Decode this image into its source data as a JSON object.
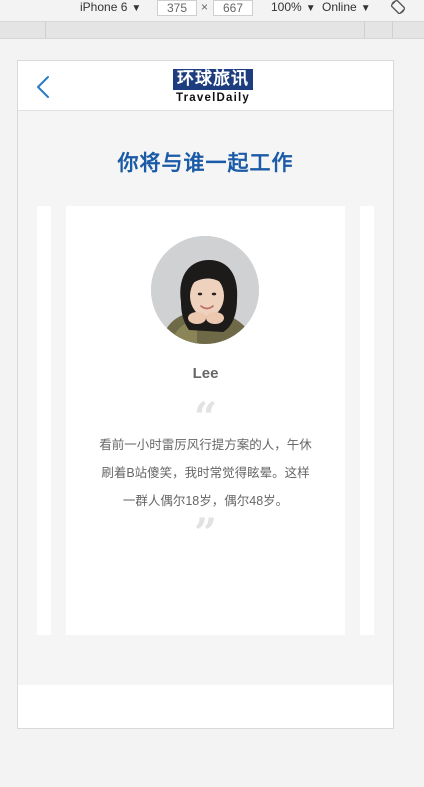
{
  "devtools": {
    "device": "iPhone 6",
    "width": "375",
    "height": "667",
    "times": "×",
    "zoom": "100%",
    "network": "Online",
    "caret": "▼",
    "rotate_icon": "rotate-icon"
  },
  "header": {
    "back_icon": "chevron-left-icon",
    "logo_cn": "环球旅讯",
    "logo_en": "TravelDaily"
  },
  "section": {
    "title": "你将与谁一起工作"
  },
  "card": {
    "avatar_icon": "avatar",
    "name": "Lee",
    "quote_open": "“",
    "quote_lines": [
      "看前一小时雷厉风行提方案的人，午休",
      "刷着B站傻笑，我时常觉得眩晕。这样",
      "一群人偶尔18岁，偶尔48岁。"
    ],
    "quote_close": "”"
  },
  "colors": {
    "title": "#1a5aa6",
    "back_arrow": "#2a7bbf",
    "logo_bg": "#1d3d7f",
    "content_bg": "#f5f5f5"
  }
}
